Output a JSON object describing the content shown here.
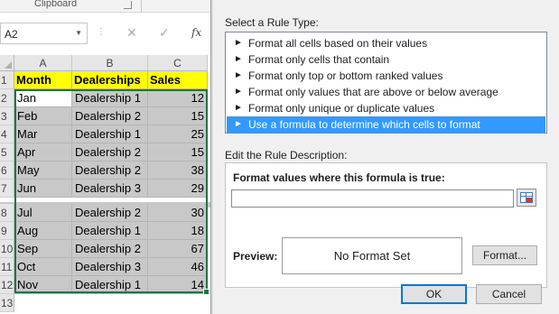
{
  "excel": {
    "ribbon_group": "Clipboard",
    "name_box": "A2",
    "formula_buttons": {
      "cancel": "✕",
      "enter": "✓",
      "function": "fx"
    },
    "columns": [
      "A",
      "B",
      "C"
    ],
    "header_row": {
      "row": "1",
      "cells": [
        "Month",
        "Dealerships",
        "Sales"
      ]
    },
    "rows": [
      {
        "row": "2",
        "month": "Jan",
        "dealership": "Dealership 1",
        "sales": "12"
      },
      {
        "row": "3",
        "month": "Feb",
        "dealership": "Dealership 2",
        "sales": "15"
      },
      {
        "row": "4",
        "month": "Mar",
        "dealership": "Dealership 1",
        "sales": "25"
      },
      {
        "row": "5",
        "month": "Apr",
        "dealership": "Dealership 2",
        "sales": "15"
      },
      {
        "row": "6",
        "month": "May",
        "dealership": "Dealership 2",
        "sales": "38"
      },
      {
        "row": "7",
        "month": "Jun",
        "dealership": "Dealership 3",
        "sales": "29"
      },
      {
        "row": "8",
        "month": "Jul",
        "dealership": "Dealership 2",
        "sales": "30"
      },
      {
        "row": "9",
        "month": "Aug",
        "dealership": "Dealership 1",
        "sales": "18"
      },
      {
        "row": "10",
        "month": "Sep",
        "dealership": "Dealership 2",
        "sales": "67"
      },
      {
        "row": "11",
        "month": "Oct",
        "dealership": "Dealership 3",
        "sales": "46"
      },
      {
        "row": "12",
        "month": "Nov",
        "dealership": "Dealership 1",
        "sales": "14"
      }
    ],
    "extra_row": "13",
    "colors": {
      "header_fill": "#ffff00",
      "cell_fill": "#c8c8c8",
      "selection": "#217346"
    }
  },
  "dialog": {
    "select_rule_type_label": "Select a Rule Type:",
    "rule_types": [
      "Format all cells based on their values",
      "Format only cells that contain",
      "Format only top or bottom ranked values",
      "Format only values that are above or below average",
      "Format only unique or duplicate values",
      "Use a formula to determine which cells to format"
    ],
    "selected_rule_index": 5,
    "edit_description_label": "Edit the Rule Description:",
    "formula_label": "Format values where this formula is true:",
    "formula_value": "",
    "preview_label": "Preview:",
    "preview_text": "No Format Set",
    "format_button": "Format...",
    "ok_button": "OK",
    "cancel_button": "Cancel",
    "colors": {
      "selection": "#3399ff",
      "primary_border": "#0078d7"
    }
  }
}
